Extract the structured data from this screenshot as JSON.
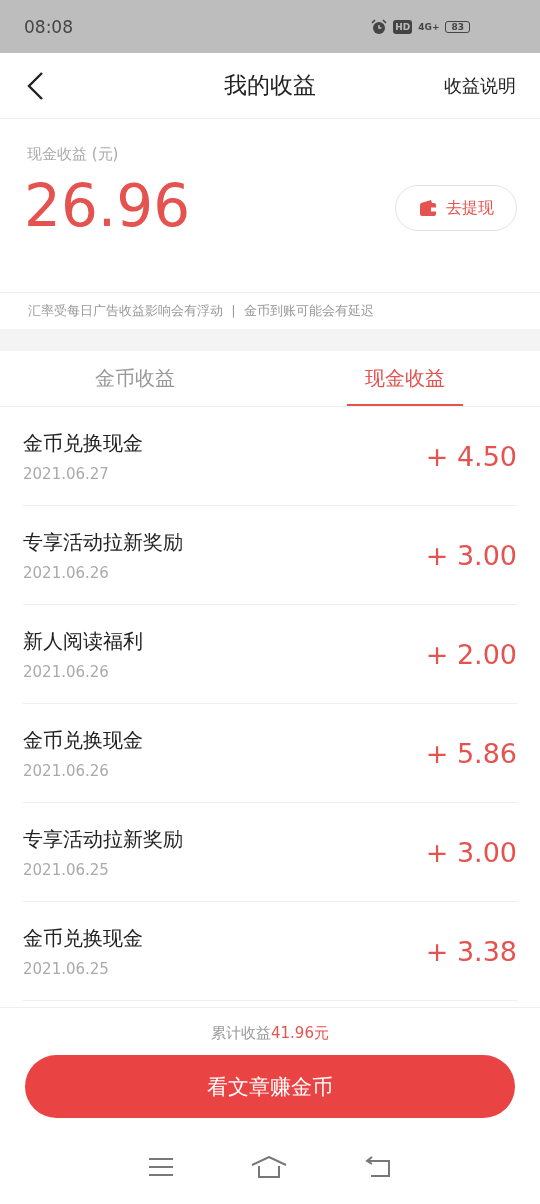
{
  "status_bar": {
    "time": "08:08",
    "hd": "HD",
    "network": "4G+",
    "battery": "83"
  },
  "header": {
    "title": "我的收益",
    "action": "收益说明"
  },
  "balance": {
    "label": "现金收益 (元)",
    "amount": "26.96",
    "withdraw": "去提现"
  },
  "notice": "汇率受每日广告收益影响会有浮动  |  金币到账可能会有延迟",
  "tabs": [
    {
      "label": "金币收益",
      "selected": false
    },
    {
      "label": "现金收益",
      "selected": true
    }
  ],
  "records": [
    {
      "title": "金币兑换现金",
      "date": "2021.06.27",
      "amount": "+ 4.50"
    },
    {
      "title": "专享活动拉新奖励",
      "date": "2021.06.26",
      "amount": "+ 3.00"
    },
    {
      "title": "新人阅读福利",
      "date": "2021.06.26",
      "amount": "+ 2.00"
    },
    {
      "title": "金币兑换现金",
      "date": "2021.06.26",
      "amount": "+ 5.86"
    },
    {
      "title": "专享活动拉新奖励",
      "date": "2021.06.25",
      "amount": "+ 3.00"
    },
    {
      "title": "金币兑换现金",
      "date": "2021.06.25",
      "amount": "+ 3.38"
    }
  ],
  "footer": {
    "total_label": "累计收益",
    "total_amount": "41.96元",
    "button": "看文章赚金币"
  }
}
